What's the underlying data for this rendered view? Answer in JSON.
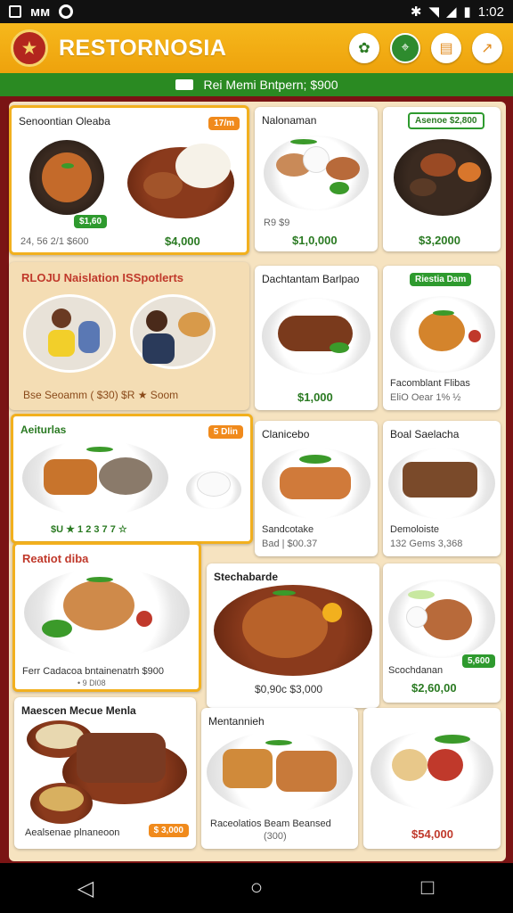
{
  "status_bar": {
    "left_glyphs": [
      "◧",
      "ᴍᴍ"
    ],
    "time": "1:02"
  },
  "header": {
    "title": "RESTORNOSIA",
    "logo_text": "★"
  },
  "banner": {
    "text": "Rei Memi Bntpern; $900"
  },
  "cards": {
    "c1": {
      "title": "Senoontian Oleaba",
      "badge": "17/m",
      "tag": "$1,60",
      "sub": "24, 56 2/1 $600",
      "price": "$4,000"
    },
    "c2": {
      "title": "Nalonaman",
      "sub": "R9 $9",
      "price": "$1,0,000"
    },
    "c3": {
      "badge": "Asenoe $2,800",
      "price": "$3,2000"
    },
    "c4": {
      "title": "RLOJU Naislation ISSpotlerts",
      "footer": "Bse Seoamm ( $30) $R ★ Soom"
    },
    "c5": {
      "title": "Dachtantam Barlpao",
      "price": "$1,000"
    },
    "c6": {
      "badge": "Riestia Dam",
      "title": "Facomblant Flibas",
      "sub": "EliO Oear 1% ½"
    },
    "c7": {
      "title": "Aeiturlas",
      "badge": "5 Dlin",
      "footer": "$U ★ 1 2 3 7 7 ☆"
    },
    "c8": {
      "title": "Clanicebo",
      "name": "Sandcotake",
      "sub": "Bad | $00.37"
    },
    "c9": {
      "title": "Boal Saelacha",
      "name": "Demoloiste",
      "sub": "132 Gems 3,368"
    },
    "c10": {
      "title": "Reatiot diba",
      "footer": "Ferr Cadacoa bntainenatrh $900",
      "sub": "• 9 Dl08"
    },
    "c11": {
      "title": "Stechabarde",
      "price": "$0,90c $3,000"
    },
    "c12": {
      "title": "Scochdanan",
      "badge": "5,600",
      "price": "$2,60,00"
    },
    "c13": {
      "title": "Maescen Mecue Menla",
      "footer": "Aealsenae plnaneoon",
      "badge": "$ 3,000"
    },
    "c14": {
      "title": "Mentannieh",
      "footer": "Raceolatios Beam Beansed",
      "sub": "(300)"
    },
    "c15": {
      "price": "$54,000"
    }
  },
  "nav": {
    "back": "◁",
    "home": "○",
    "recents": "□"
  },
  "colors": {
    "accent": "#f2b01e",
    "green": "#2a8a22",
    "red": "#c0392b"
  }
}
